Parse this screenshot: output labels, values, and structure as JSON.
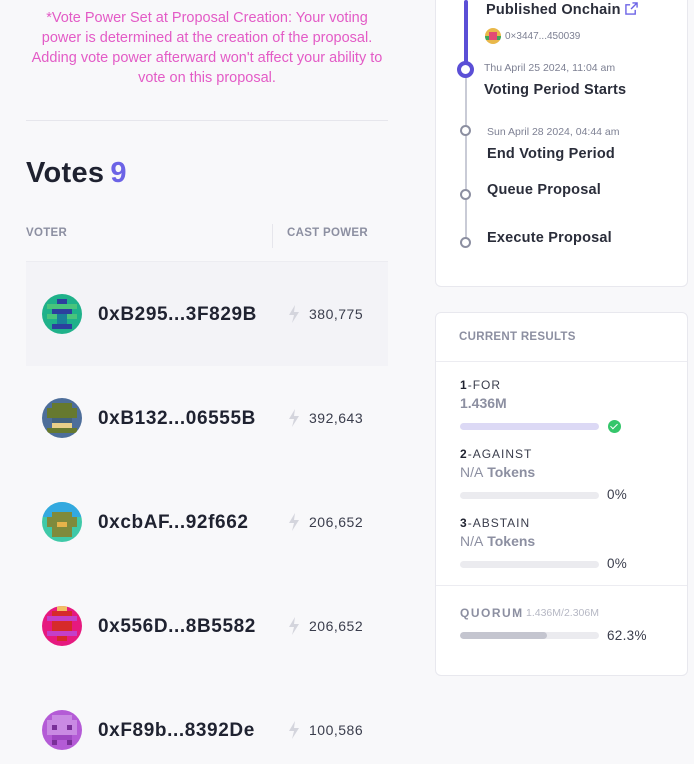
{
  "notice": "*Vote Power Set at Proposal Creation: Your voting power is determined at the creation of the proposal. Adding vote power afterward won't affect your ability to vote on this proposal.",
  "votes": {
    "title": "Votes",
    "count": "9",
    "columns": {
      "voter": "VOTER",
      "cast_power": "CAST POWER"
    },
    "rows": [
      {
        "address": "0xB295...3F829B",
        "power": "380,775"
      },
      {
        "address": "0xB132...06555B",
        "power": "392,643"
      },
      {
        "address": "0xcbAF...92f662",
        "power": "206,652"
      },
      {
        "address": "0x556D...8B5582",
        "power": "206,652"
      },
      {
        "address": "0xF89b...8392De",
        "power": "100,586"
      }
    ]
  },
  "timeline": {
    "published": {
      "title": "Published Onchain",
      "address": "0×3447...450039"
    },
    "voting_start": {
      "date": "Thu April 25 2024, 11:04 am",
      "title": "Voting Period Starts"
    },
    "voting_end": {
      "date": "Sun April 28 2024, 04:44 am",
      "title": "End Voting Period"
    },
    "queue": {
      "title": "Queue Proposal"
    },
    "execute": {
      "title": "Execute Proposal"
    }
  },
  "results": {
    "header": "CURRENT RESULTS",
    "options": [
      {
        "index": "1",
        "label": "FOR",
        "value": "1.436M",
        "unit": "",
        "percent": "",
        "fill": 1.0,
        "winner": true
      },
      {
        "index": "2",
        "label": "AGAINST",
        "value": "N/A",
        "unit": "Tokens",
        "percent": "0%",
        "fill": 0.0,
        "winner": false
      },
      {
        "index": "3",
        "label": "ABSTAIN",
        "value": "N/A",
        "unit": "Tokens",
        "percent": "0%",
        "fill": 0.0,
        "winner": false
      }
    ],
    "quorum": {
      "label": "QUORUM",
      "values": "1.436M/2.306M",
      "percent": "62.3%",
      "fill": 0.623
    }
  },
  "colors": {
    "accent": "#5b4fd6",
    "notice": "#e35bc6",
    "success": "#35c66b"
  },
  "icons": {
    "external_link": "external-link-icon",
    "bolt": "bolt-icon",
    "check": "check-icon"
  }
}
